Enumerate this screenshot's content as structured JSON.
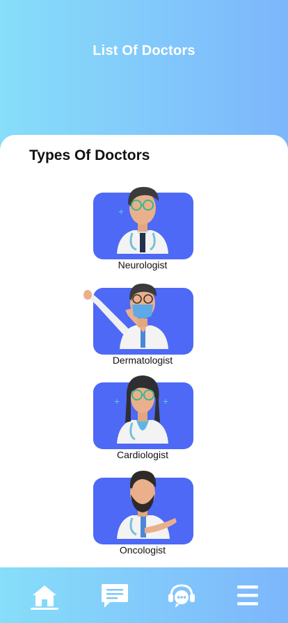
{
  "header": {
    "title": "List Of Doctors"
  },
  "main": {
    "section_title": "Types Of Doctors",
    "doctors": [
      {
        "label": "Neurologist",
        "icon": "doctor-avatar-icon"
      },
      {
        "label": "Dermatologist",
        "icon": "doctor-avatar-icon"
      },
      {
        "label": "Cardiologist",
        "icon": "doctor-avatar-icon"
      },
      {
        "label": "Oncologist",
        "icon": "doctor-avatar-icon"
      }
    ]
  },
  "bottom_nav": {
    "items": [
      {
        "icon": "home-icon",
        "active": true
      },
      {
        "icon": "chat-icon",
        "active": false
      },
      {
        "icon": "support-icon",
        "active": false
      },
      {
        "icon": "menu-icon",
        "active": false
      }
    ]
  },
  "colors": {
    "header_gradient_start": "#86def9",
    "header_gradient_end": "#7cb6fb",
    "tile": "#4d69f5",
    "text": "#111111"
  }
}
